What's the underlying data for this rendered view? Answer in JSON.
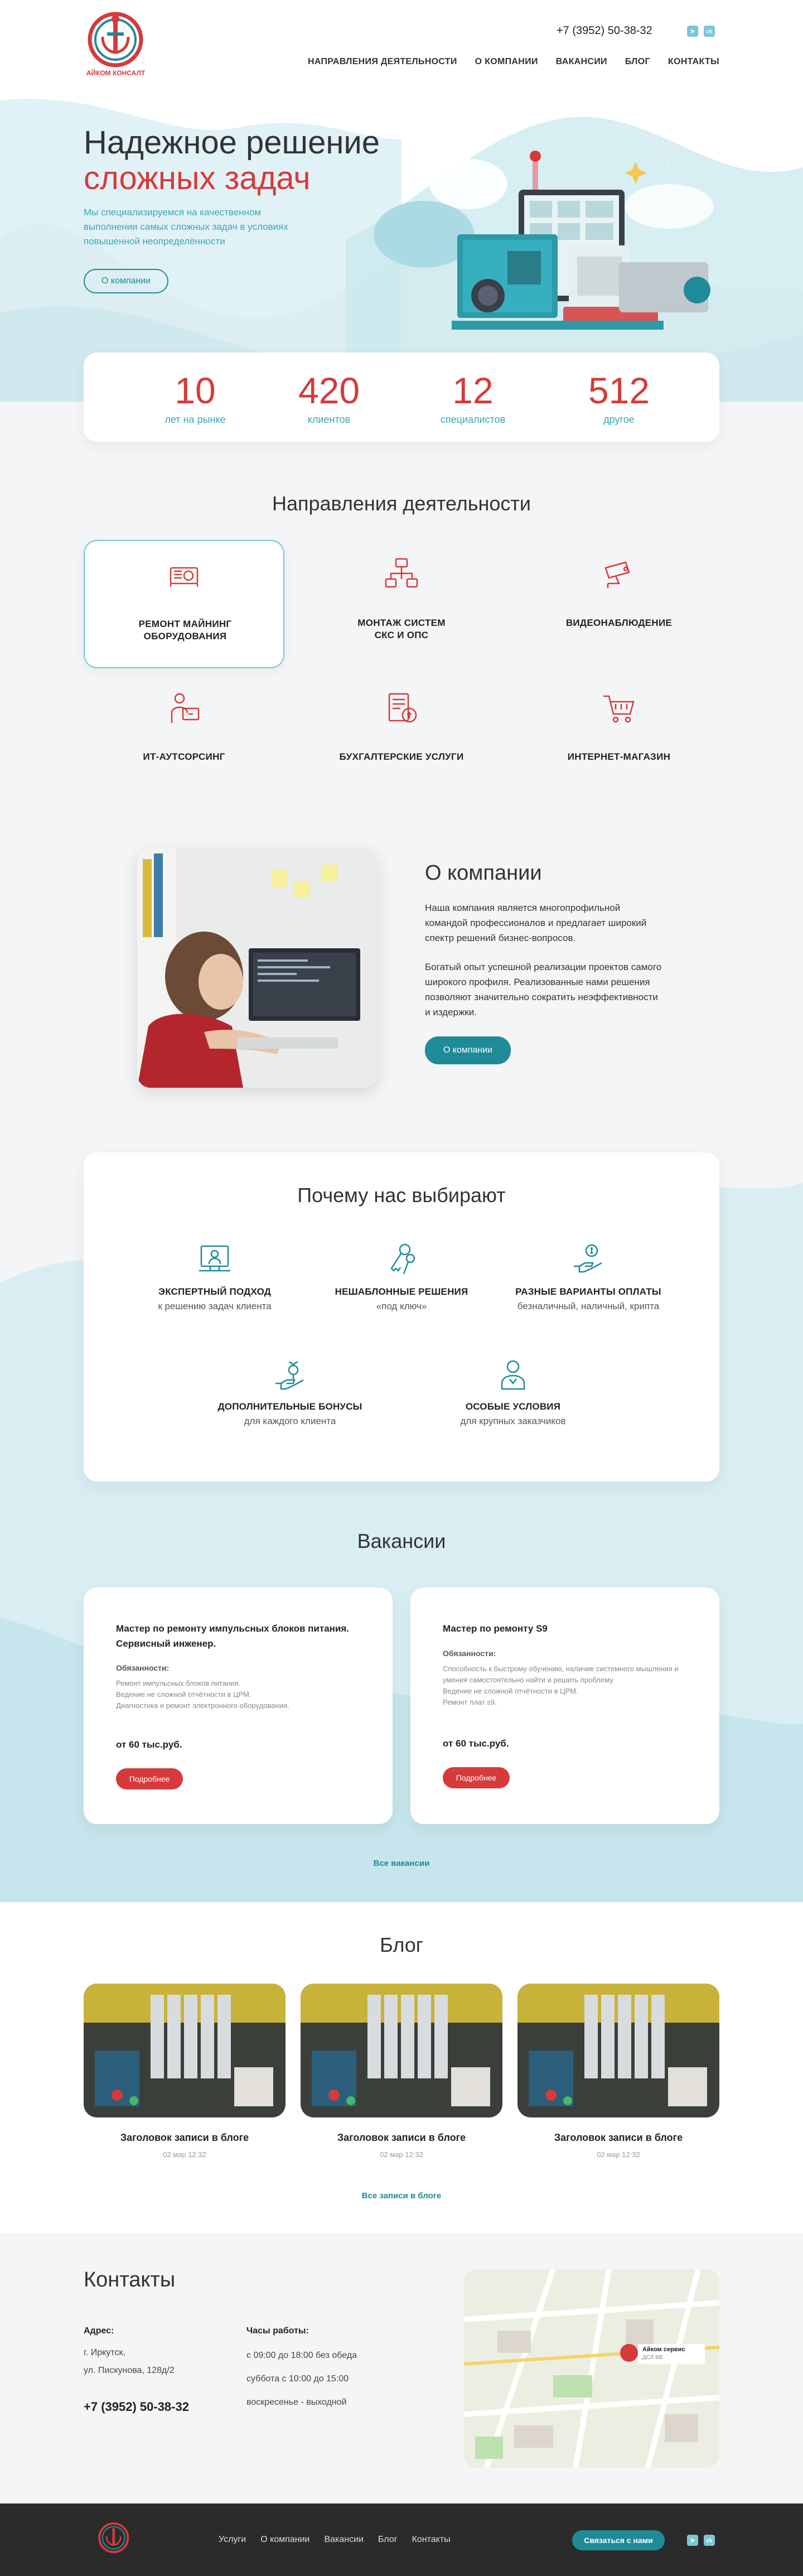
{
  "header": {
    "logo_text": "АЙКОМ КОНСАЛТ",
    "phone": "+7 (3952) 50-38-32",
    "nav": [
      "НАПРАВЛЕНИЯ ДЕЯТЕЛЬНОСТИ",
      "О КОМПАНИИ",
      "ВАКАНСИИ",
      "БЛОГ",
      "КОНТАКТЫ"
    ],
    "social_icons": [
      "telegram-icon",
      "vk-icon"
    ]
  },
  "hero": {
    "title_line1": "Надежное решение",
    "title_line2": "сложных задач",
    "subtitle": "Мы специализируемся на качественном выполнении самых сложных задач в условиях повышенной неопределённости",
    "button": "О компании"
  },
  "stats": [
    {
      "value": "10",
      "label": "лет на рынке"
    },
    {
      "value": "420",
      "label": "клиентов"
    },
    {
      "value": "12",
      "label": "специалистов"
    },
    {
      "value": "512",
      "label": "другое"
    }
  ],
  "directions": {
    "title": "Направления деятельности",
    "items": [
      {
        "label": "РЕМОНТ МАЙНИНГ\nОБОРУДОВАНИЯ",
        "icon": "mining-rig-icon"
      },
      {
        "label": "МОНТАЖ СИСТЕМ\nСКС И ОПС",
        "icon": "network-icon"
      },
      {
        "label": "ВИДЕОНАБЛЮДЕНИЕ",
        "icon": "cctv-camera-icon"
      },
      {
        "label": "ИТ-АУТСОРСИНГ",
        "icon": "it-support-icon"
      },
      {
        "label": "БУХГАЛТЕРСКИЕ УСЛУГИ",
        "icon": "accounting-icon"
      },
      {
        "label": "ИНТЕРНЕТ-МАГАЗИН",
        "icon": "shopping-cart-icon"
      }
    ]
  },
  "about": {
    "title": "О компании",
    "p1": "Наша компания является многопрофильной командой профессионалов и предлагает широкий спектр решений бизнес-вопросов.",
    "p2": "Богатый опыт успешной реализации проектов самого широкого профиля. Реализованные нами решения позволяют значительно сократить неэффективности и издержки.",
    "button": "О компании"
  },
  "why": {
    "title": "Почему нас выбирают",
    "items": [
      {
        "title": "ЭКСПЕРТНЫЙ ПОДХОД",
        "sub": "к решению задач клиента",
        "icon": "expert-monitor-icon"
      },
      {
        "title": "НЕШАБЛОННЫЕ РЕШЕНИЯ",
        "sub": "«под ключ»",
        "icon": "keys-icon"
      },
      {
        "title": "РАЗНЫЕ ВАРИАНТЫ ОПЛАТЫ",
        "sub": "безналичный, наличный, крипта",
        "icon": "payment-hand-icon"
      },
      {
        "title": "ДОПОЛНИТЕЛЬНЫЕ БОНУСЫ",
        "sub": "для каждого клиента",
        "icon": "bonus-plant-icon"
      },
      {
        "title": "ОСОБЫЕ УСЛОВИЯ",
        "sub": "для крупных заказчиков",
        "icon": "client-person-icon"
      }
    ]
  },
  "vacancies": {
    "title": "Вакансии",
    "items": [
      {
        "title": "Мастер по ремонту импульсных блоков питания. Сервисный инженер.",
        "duties_label": "Обязанности:",
        "duties": "Ремонт импульсных блоков питания.\nВедение не сложной отчётности в ЦРМ.\nДиагностика и ремонт электронного оборудования.",
        "salary": "от 60 тыс.руб.",
        "button": "Подробнее"
      },
      {
        "title": "Мастер по ремонту S9",
        "duties_label": "Обязанности:",
        "duties": "Способность к быстрому обучению, наличие системного мышления и умения самостоятельно найти и решить проблему.\nВедение не сложной отчётности в ЦРМ.\nРемонт плат s9.",
        "salary": "от 60 тыс.руб.",
        "button": "Подробнее"
      }
    ],
    "all_link": "Все вакансии"
  },
  "blog": {
    "title": "Блог",
    "posts": [
      {
        "title": "Заголовок записи в блоге",
        "date": "02 мар 12:32"
      },
      {
        "title": "Заголовок записи в блоге",
        "date": "02 мар 12:32"
      },
      {
        "title": "Заголовок записи в блоге",
        "date": "02 мар 12:32"
      }
    ],
    "all_link": "Все записи в блоге"
  },
  "contacts": {
    "title": "Контакты",
    "address_label": "Адрес:",
    "address": "г. Иркутск,\nул. Пискунова, 128д/2",
    "phone": "+7 (3952) 50-38-32",
    "hours_label": "Часы работы:",
    "hours": "с 09:00 до 18:00 без обеда\nсуббота с 10:00 до 15:00\nвоскресенье - выходной",
    "map_label": "Айком сервис",
    "map_sublabel": "ДСЛ ВВ"
  },
  "footer": {
    "nav": [
      "Услуги",
      "О компании",
      "Вакансии",
      "Блог",
      "Контакты"
    ],
    "button": "Связаться с нами"
  },
  "colors": {
    "accent_red": "#d63a3a",
    "accent_teal": "#1f8a98",
    "light_teal": "#7cc6d4"
  }
}
